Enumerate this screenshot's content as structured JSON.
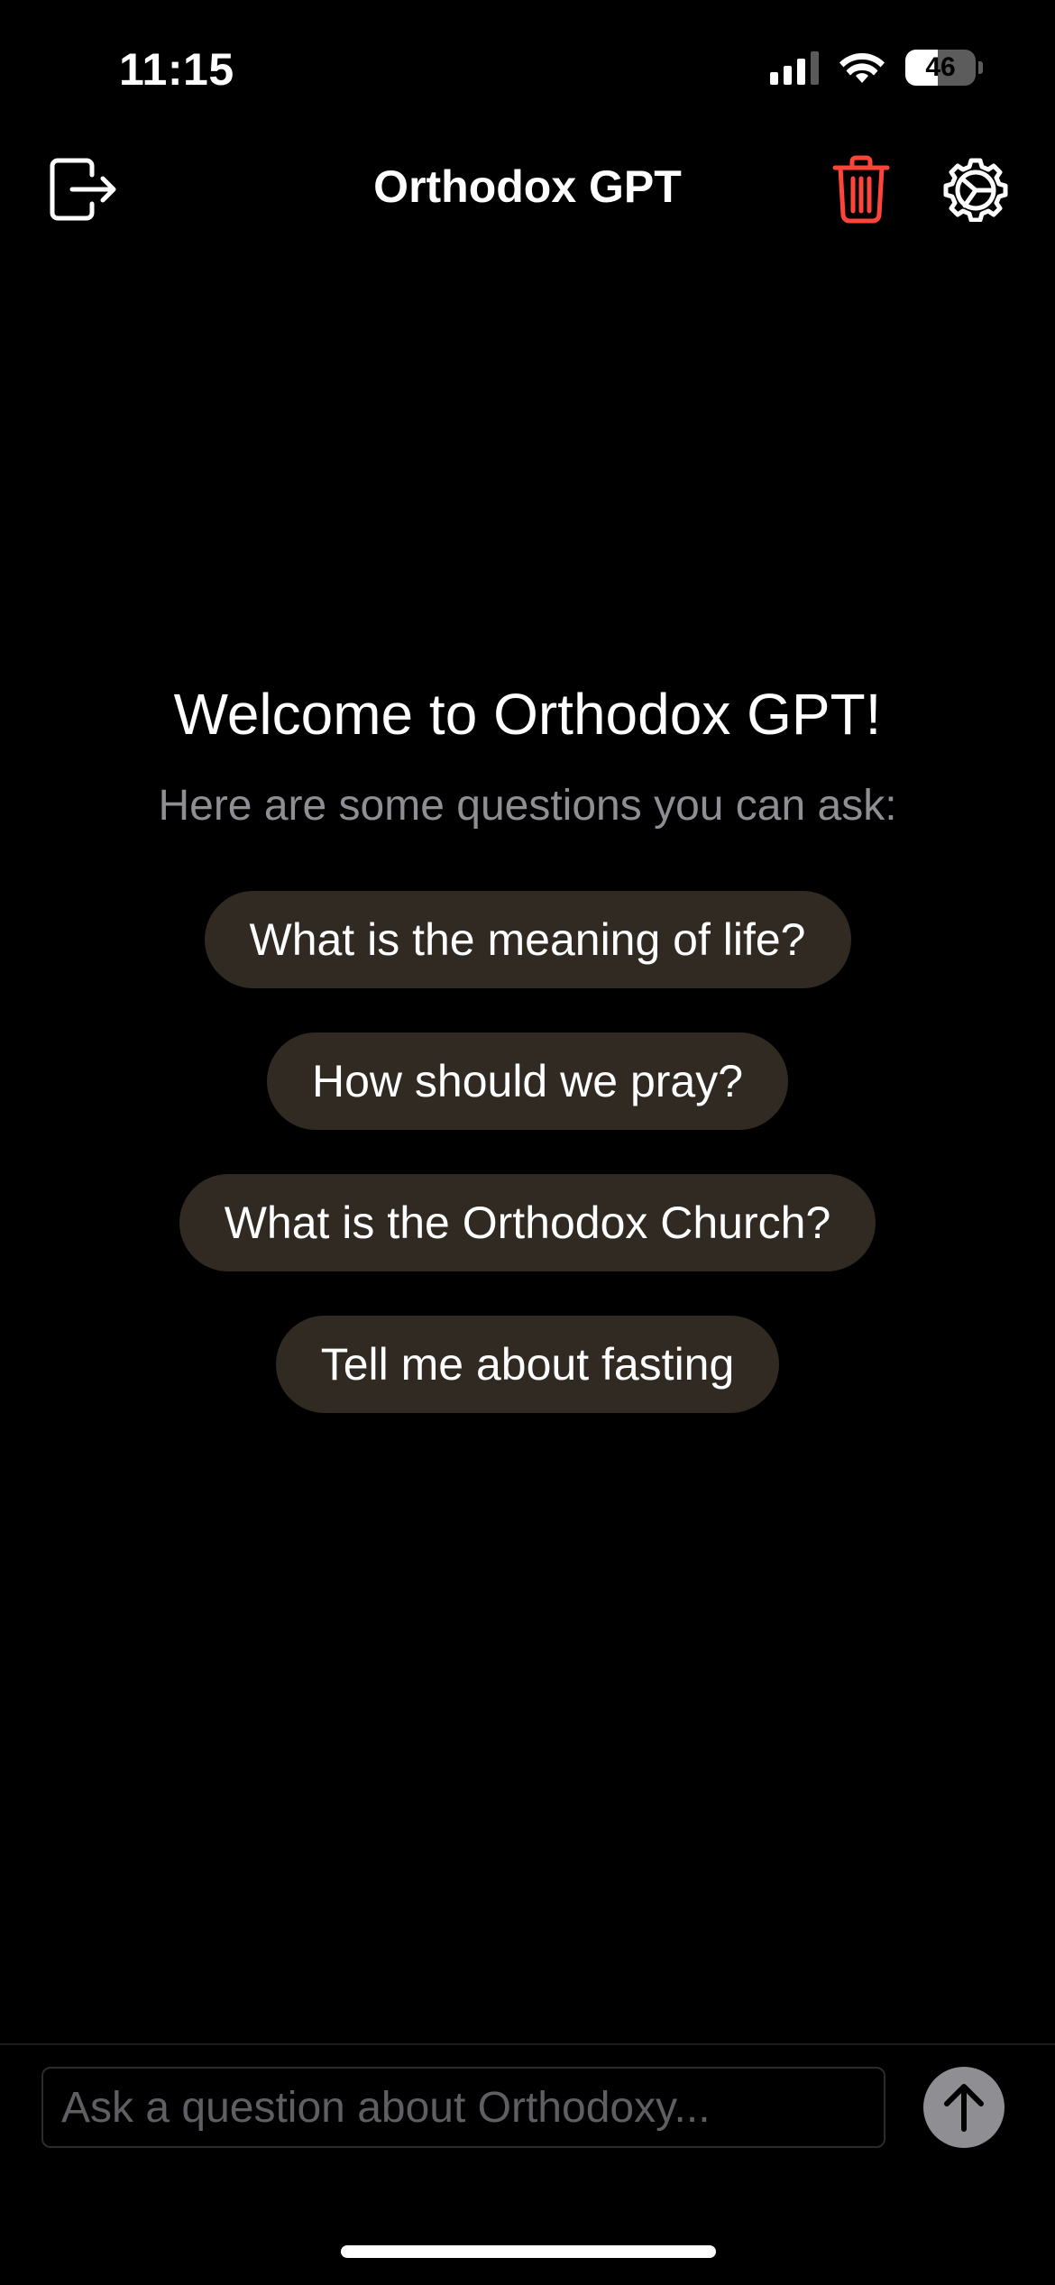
{
  "status_bar": {
    "time": "11:15",
    "battery_level": "46",
    "battery_fraction": 0.46,
    "icons": [
      "cellular-signal-icon",
      "wifi-icon",
      "battery-icon"
    ]
  },
  "nav": {
    "title": "Orthodox GPT",
    "icons": [
      "logout-icon",
      "trash-icon",
      "settings-icon"
    ],
    "trash_color": "#ff453a"
  },
  "welcome": {
    "title": "Welcome to Orthodox GPT!",
    "subtitle": "Here are some questions you can ask:"
  },
  "suggestions": [
    "What is the meaning of life?",
    "How should we pray?",
    "What is the Orthodox Church?",
    "Tell me about fasting"
  ],
  "composer": {
    "placeholder": "Ask a question about Orthodoxy...",
    "value": "",
    "send_icon": "arrow-up-icon"
  },
  "colors": {
    "background": "#000000",
    "chip_background": "#302a23",
    "subtitle": "#8e8e93",
    "send_button": "#8e8e93"
  }
}
